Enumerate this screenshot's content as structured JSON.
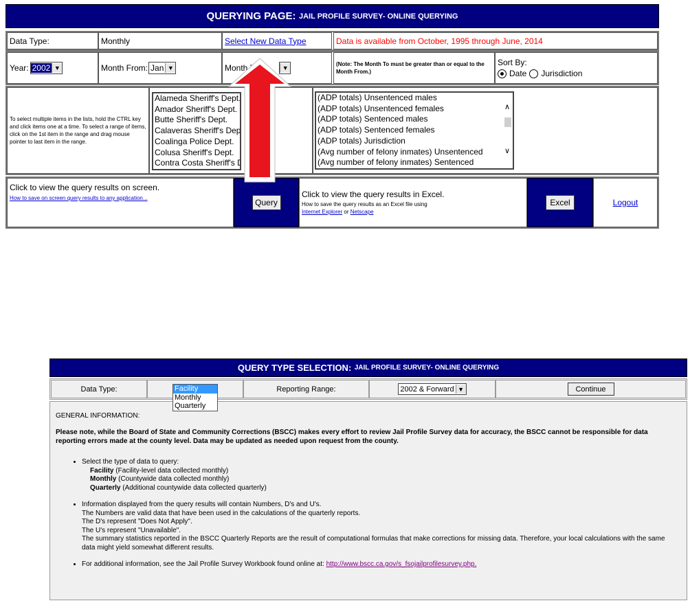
{
  "query_page": {
    "banner": {
      "title_bold": "QUERYING PAGE:",
      "title_rest": "JAIL PROFILE SURVEY- ONLINE QUERYING"
    },
    "row1": {
      "data_type_label": "Data Type:",
      "data_type_value": "Monthly",
      "select_new_link": "Select New Data Type",
      "availability": "Data is available from October, 1995 through June, 2014"
    },
    "row2": {
      "year_label": "Year:",
      "year_value": "2002",
      "month_from_label": "Month From:",
      "month_from_value": "Jan",
      "month_to_label": "Month To",
      "note": "(Note: The Month To must be greater than or equal to the Month From.)",
      "sort_by_label": "Sort By:",
      "sort_date": "Date",
      "sort_jurisdiction": "Jurisdiction",
      "sort_selected": "Date"
    },
    "instructions": "To select multiple items in the lists, hold the CTRL key and click items one at a time. To select a range of items, click on the 1st item in the range and drag mouse pointer to last item in the range.",
    "jurisdictions": [
      "Alameda Sheriff's Dept.",
      "Amador Sheriff's Dept.",
      "Butte Sheriff's Dept.",
      "Calaveras Sheriff's Dept.",
      "Coalinga Police Dept.",
      "Colusa Sheriff's Dept.",
      "Contra Costa Sheriff's Dept."
    ],
    "measures": [
      "(ADP totals) Unsentenced males",
      "(ADP totals) Unsentenced females",
      "(ADP totals) Sentenced males",
      "(ADP totals) Sentenced females",
      "(ADP totals) Jurisdiction",
      "(Avg number of felony inmates) Unsentenced",
      "(Avg number of felony inmates) Sentenced"
    ],
    "bottom": {
      "screen_text": "Click to view the query results on screen.",
      "screen_help_link": "How to save on screen query results to any application...",
      "query_button": "Query",
      "excel_text": "Click to view the query results in Excel.",
      "excel_help": "How to save the query results as an Excel file using",
      "ie_link": "Internet Explorer",
      "or_text": "or",
      "netscape_link": "Netscape",
      "excel_button": "Excel",
      "logout_link": "Logout"
    },
    "colors": {
      "navy": "#000080",
      "red_arrow": "#e8141e",
      "link": "#0000cc"
    }
  },
  "type_selection": {
    "banner": {
      "title_bold": "QUERY TYPE SELECTION:",
      "title_rest": "JAIL PROFILE SURVEY- ONLINE QUERYING"
    },
    "data_type_label": "Data Type:",
    "data_type_options": [
      "Facility",
      "Monthly",
      "Quarterly"
    ],
    "data_type_selected": "Facility",
    "reporting_range_label": "Reporting Range:",
    "reporting_range_value": "2002 & Forward",
    "continue_button": "Continue",
    "general_heading": "GENERAL INFORMATION:",
    "disclaimer": "Please note, while the Board of State and Community Corrections (BSCC) makes every effort to review Jail Profile Survey data for accuracy, the BSCC cannot be responsible for data reporting errors made at the county level. Data may be updated as needed upon request from the county.",
    "bullet1_intro": "Select the type of data to query:",
    "bullet1_items": [
      {
        "name": "Facility",
        "desc": "(Facility-level data collected monthly)"
      },
      {
        "name": "Monthly",
        "desc": "(Countywide data collected monthly)"
      },
      {
        "name": "Quarterly",
        "desc": "(Additional countywide data collected quarterly)"
      }
    ],
    "bullet2_lines": [
      "Information displayed from the query results will contain Numbers, D's and U's.",
      "The Numbers are valid data that have been used in the calculations of the quarterly reports.",
      "The D's represent \"Does Not Apply\".",
      "The U's represent \"Unavailable\".",
      "The summary statistics reported in the BSCC Quarterly Reports are the result of computational formulas that make corrections for missing data. Therefore, your local calculations with the same data might yield somewhat different results."
    ],
    "bullet3_text": "For additional information, see the Jail Profile Survey Workbook found online at:",
    "bullet3_link": "http://www.bscc.ca.gov/s_fsojailprofilesurvey.php."
  }
}
